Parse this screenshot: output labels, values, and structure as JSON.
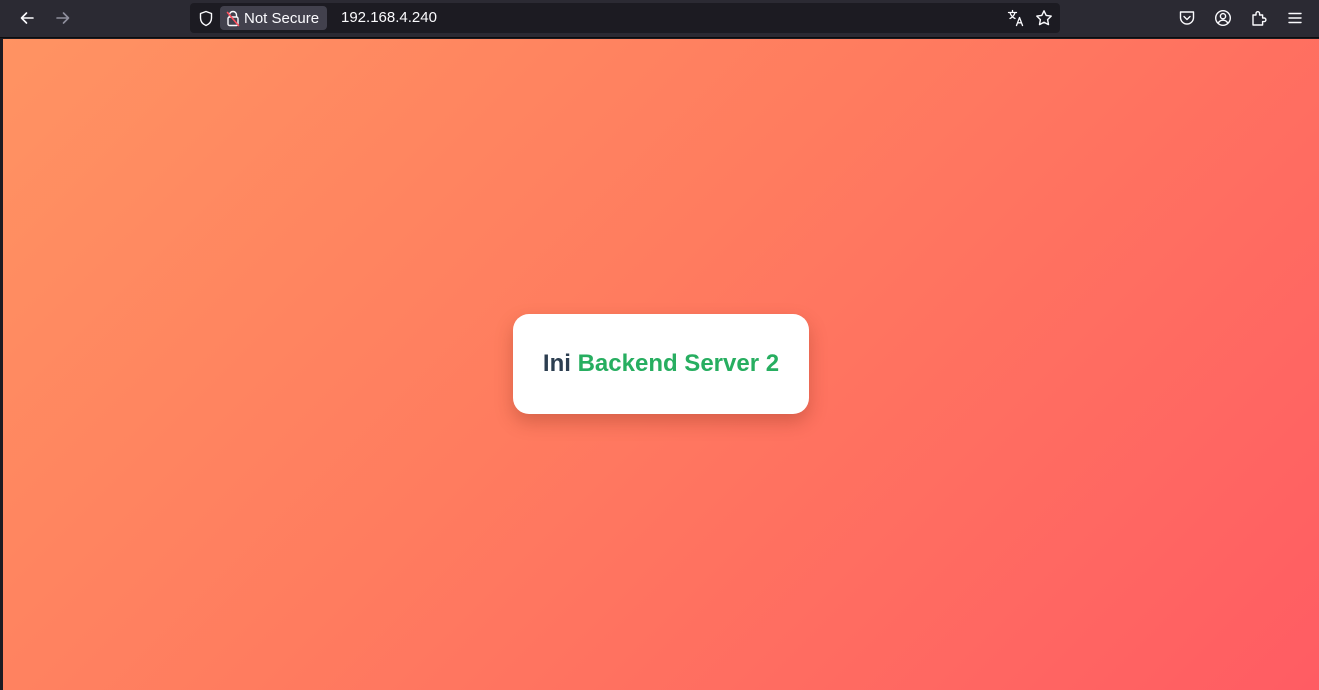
{
  "browser": {
    "security_label": "Not Secure",
    "url": "192.168.4.240",
    "icons": [
      "back-arrow-icon",
      "forward-arrow-icon",
      "shield-icon",
      "insecure-lock-icon",
      "translate-icon",
      "star-icon",
      "pocket-icon",
      "account-icon",
      "extensions-icon",
      "menu-icon"
    ]
  },
  "page": {
    "prefix": "Ini",
    "highlight": "Backend Server 2",
    "highlight_color": "#27ae60",
    "text_color": "#2c3e50",
    "background_gradient": [
      "#ff9362",
      "#ff5c63"
    ]
  }
}
